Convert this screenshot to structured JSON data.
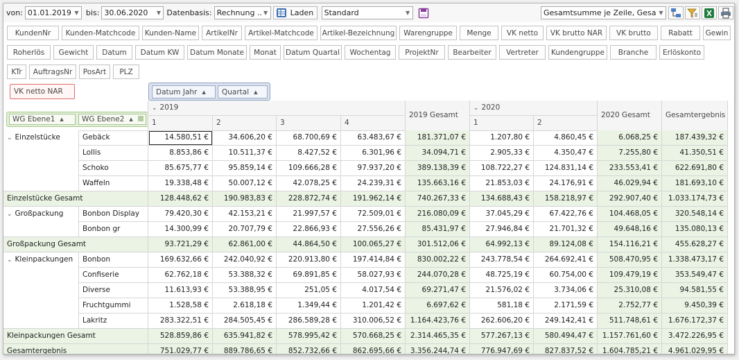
{
  "toolbar": {
    "von_label": "von:",
    "von_value": "01.01.2019",
    "bis_label": "bis:",
    "bis_value": "30.06.2020",
    "datenbasis_label": "Datenbasis:",
    "datenbasis_value": "Rechnung ...",
    "laden_label": "Laden",
    "layout_value": "Standard",
    "summary_value": "Gesamtsumme je Zeile, Gesamtsu..."
  },
  "field_chips": {
    "row1": [
      "KundenNr",
      "Kunden-Matchcode",
      "Kunden-Name",
      "ArtikelNr",
      "Artikel-Matchcode",
      "Artikel-Bezeichnung",
      "Warengruppe",
      "Menge",
      "VK netto",
      "VK brutto NAR",
      "VK brutto",
      "Rabatt",
      "Gewin"
    ],
    "row2": [
      "Roherlös",
      "Gewicht",
      "Datum",
      "Datum KW",
      "Datum Monate",
      "Monat",
      "Datum Quartal",
      "Wochentag",
      "ProjektNr",
      "Bearbeiter",
      "Vertreter",
      "Kundengruppe",
      "Branche",
      "Erlöskonto"
    ],
    "row3": [
      "KTr",
      "AuftragsNr",
      "PosArt",
      "PLZ"
    ]
  },
  "data_field": "VK netto NAR",
  "column_fields": [
    "Datum Jahr",
    "Quartal"
  ],
  "row_fields": [
    "WG Ebene1",
    "WG Ebene2"
  ],
  "years": [
    "2019",
    "2020"
  ],
  "quarter_headers": [
    "1",
    "2",
    "3",
    "4",
    "1",
    "2"
  ],
  "total_headers": {
    "y2019": "2019 Gesamt",
    "y2020": "2020 Gesamt",
    "grand": "Gesamtergebnis"
  },
  "rows": [
    {
      "type": "item",
      "group": "Einzelstücke",
      "label": "Gebäck",
      "values": [
        "14.580,51 €",
        "34.606,20 €",
        "68.700,69 €",
        "63.483,67 €",
        "181.371,07 €",
        "1.207,80 €",
        "4.860,45 €",
        "6.068,25 €",
        "187.439,32 €"
      ]
    },
    {
      "type": "item",
      "group": "",
      "label": "Lollis",
      "values": [
        "8.853,86 €",
        "10.511,37 €",
        "8.427,52 €",
        "6.301,96 €",
        "34.094,71 €",
        "2.905,33 €",
        "4.350,47 €",
        "7.255,80 €",
        "41.350,51 €"
      ]
    },
    {
      "type": "item",
      "group": "",
      "label": "Schoko",
      "values": [
        "85.675,77 €",
        "95.859,14 €",
        "109.666,28 €",
        "97.937,20 €",
        "389.138,39 €",
        "108.722,27 €",
        "124.831,14 €",
        "233.553,41 €",
        "622.691,80 €"
      ]
    },
    {
      "type": "item",
      "group": "",
      "label": "Waffeln",
      "values": [
        "19.338,48 €",
        "50.007,12 €",
        "42.078,25 €",
        "24.239,31 €",
        "135.663,16 €",
        "21.853,03 €",
        "24.176,91 €",
        "46.029,94 €",
        "181.693,10 €"
      ]
    },
    {
      "type": "total",
      "group": "",
      "label": "Einzelstücke Gesamt",
      "values": [
        "128.448,62 €",
        "190.983,83 €",
        "228.872,74 €",
        "191.962,14 €",
        "740.267,33 €",
        "134.688,43 €",
        "158.218,97 €",
        "292.907,40 €",
        "1.033.174,73 €"
      ]
    },
    {
      "type": "item",
      "group": "Großpackung",
      "label": "Bonbon Display",
      "values": [
        "79.420,30 €",
        "42.153,21 €",
        "21.997,57 €",
        "72.509,01 €",
        "216.080,09 €",
        "37.045,29 €",
        "67.422,76 €",
        "104.468,05 €",
        "320.548,14 €"
      ]
    },
    {
      "type": "item",
      "group": "",
      "label": "Bonbon gr",
      "values": [
        "14.300,99 €",
        "20.707,79 €",
        "22.866,93 €",
        "27.556,26 €",
        "85.431,97 €",
        "27.946,84 €",
        "21.701,32 €",
        "49.648,16 €",
        "135.080,13 €"
      ]
    },
    {
      "type": "total",
      "group": "",
      "label": "Großpackung Gesamt",
      "values": [
        "93.721,29 €",
        "62.861,00 €",
        "44.864,50 €",
        "100.065,27 €",
        "301.512,06 €",
        "64.992,13 €",
        "89.124,08 €",
        "154.116,21 €",
        "455.628,27 €"
      ]
    },
    {
      "type": "item",
      "group": "Kleinpackungen",
      "label": "Bonbon",
      "values": [
        "169.632,66 €",
        "242.040,92 €",
        "220.913,80 €",
        "197.414,84 €",
        "830.002,22 €",
        "243.778,54 €",
        "264.692,41 €",
        "508.470,95 €",
        "1.338.473,17 €"
      ]
    },
    {
      "type": "item",
      "group": "",
      "label": "Confiserie",
      "values": [
        "62.762,18 €",
        "53.388,32 €",
        "69.891,85 €",
        "58.027,93 €",
        "244.070,28 €",
        "48.725,19 €",
        "60.754,00 €",
        "109.479,19 €",
        "353.549,47 €"
      ]
    },
    {
      "type": "item",
      "group": "",
      "label": "Diverse",
      "values": [
        "11.613,93 €",
        "53.388,95 €",
        "251,05 €",
        "4.017,54 €",
        "69.271,47 €",
        "21.576,02 €",
        "3.734,06 €",
        "25.310,08 €",
        "94.581,55 €"
      ]
    },
    {
      "type": "item",
      "group": "",
      "label": "Fruchtgummi",
      "values": [
        "1.528,58 €",
        "2.618,18 €",
        "1.349,44 €",
        "1.201,42 €",
        "6.697,62 €",
        "581,18 €",
        "2.171,59 €",
        "2.752,77 €",
        "9.450,39 €"
      ]
    },
    {
      "type": "item",
      "group": "",
      "label": "Lakritz",
      "values": [
        "283.322,51 €",
        "284.505,45 €",
        "286.589,28 €",
        "310.006,52 €",
        "1.164.423,76 €",
        "262.606,20 €",
        "249.142,41 €",
        "511.748,61 €",
        "1.676.172,37 €"
      ]
    },
    {
      "type": "total",
      "group": "",
      "label": "Kleinpackungen Gesamt",
      "values": [
        "528.859,86 €",
        "635.941,82 €",
        "578.995,42 €",
        "570.668,25 €",
        "2.314.465,35 €",
        "577.267,13 €",
        "580.494,47 €",
        "1.157.761,60 €",
        "3.472.226,95 €"
      ]
    },
    {
      "type": "total",
      "group": "",
      "label": "Gesamtergebnis",
      "values": [
        "751.029,77 €",
        "889.786,65 €",
        "852.732,66 €",
        "862.695,66 €",
        "3.356.244,74 €",
        "776.947,69 €",
        "827.837,52 €",
        "1.604.785,21 €",
        "4.961.029,95 €"
      ]
    }
  ],
  "colors": {
    "total_row_bg": "#eaf3e4",
    "filter_border": "#e06b6b",
    "column_area_bg": "#dde4f0",
    "row_area_bg": "#e4f0da"
  }
}
